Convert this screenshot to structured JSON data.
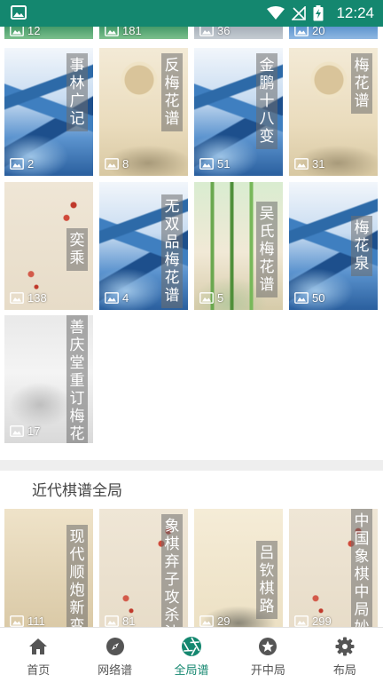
{
  "status_bar": {
    "time": "12:24"
  },
  "top_row": [
    {
      "count": "12",
      "theme": "green"
    },
    {
      "count": "181",
      "theme": "green"
    },
    {
      "count": "36",
      "theme": "gray"
    },
    {
      "count": "20",
      "theme": "mtn-top"
    }
  ],
  "grid_rows": [
    [
      {
        "title": "事林广记",
        "count": "2",
        "theme": "mountain"
      },
      {
        "title": "反梅花谱",
        "count": "8",
        "theme": "parchment"
      },
      {
        "title": "金鹏十八变",
        "count": "51",
        "theme": "mountain"
      },
      {
        "title": "梅花谱",
        "count": "31",
        "theme": "parchment"
      }
    ],
    [
      {
        "title": "奕乘",
        "count": "138",
        "theme": "plum"
      },
      {
        "title": "无双品梅花谱",
        "count": "4",
        "theme": "mountain"
      },
      {
        "title": "吴氏梅花谱",
        "count": "5",
        "theme": "bamboo"
      },
      {
        "title": "梅花泉",
        "count": "50",
        "theme": "mountain"
      }
    ],
    [
      {
        "title": "善庆堂重订梅花变",
        "count": "17",
        "theme": "snow"
      }
    ]
  ],
  "section": {
    "title": "近代棋谱全局"
  },
  "modern_row": [
    {
      "title": "现代顺炮新变",
      "count": "111",
      "theme": "warm"
    },
    {
      "title": "象棋弃子攻杀法",
      "count": "81",
      "theme": "plum"
    },
    {
      "title": "吕钦棋路",
      "count": "29",
      "theme": "paper2"
    },
    {
      "title": "中国象棋中局妙手",
      "count": "299",
      "theme": "plum"
    }
  ],
  "bottom_nav": [
    {
      "label": "首页",
      "icon": "home-icon",
      "active": false
    },
    {
      "label": "网络谱",
      "icon": "compass-icon",
      "active": false
    },
    {
      "label": "全局谱",
      "icon": "aperture-icon",
      "active": true
    },
    {
      "label": "开中局",
      "icon": "star-badge-icon",
      "active": false
    },
    {
      "label": "布局",
      "icon": "gear-icon",
      "active": false
    }
  ],
  "colors": {
    "primary": "#14876f",
    "nav_text": "#555555"
  }
}
